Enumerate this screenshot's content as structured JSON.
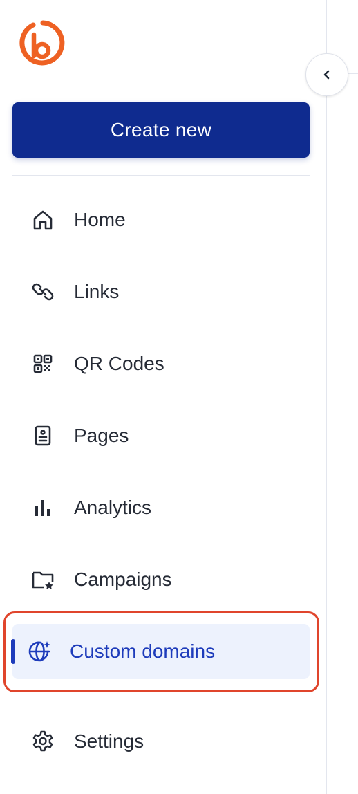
{
  "brand": {
    "logo_icon": "bitly-logo-icon",
    "accent": "#ee6123"
  },
  "sidebar": {
    "collapse_icon": "chevron-left-icon",
    "create_button_label": "Create new",
    "create_button_color": "#0f2b8f",
    "items": [
      {
        "label": "Home",
        "icon": "home-icon"
      },
      {
        "label": "Links",
        "icon": "link-icon"
      },
      {
        "label": "QR Codes",
        "icon": "qr-code-icon"
      },
      {
        "label": "Pages",
        "icon": "page-icon"
      },
      {
        "label": "Analytics",
        "icon": "bar-chart-icon"
      },
      {
        "label": "Campaigns",
        "icon": "folder-star-icon"
      },
      {
        "label": "Custom domains",
        "icon": "globe-sparkle-icon",
        "active": true
      },
      {
        "label": "Settings",
        "icon": "gear-icon"
      }
    ],
    "active_color": "#1e3cbb",
    "highlight_color": "#e0452c"
  }
}
